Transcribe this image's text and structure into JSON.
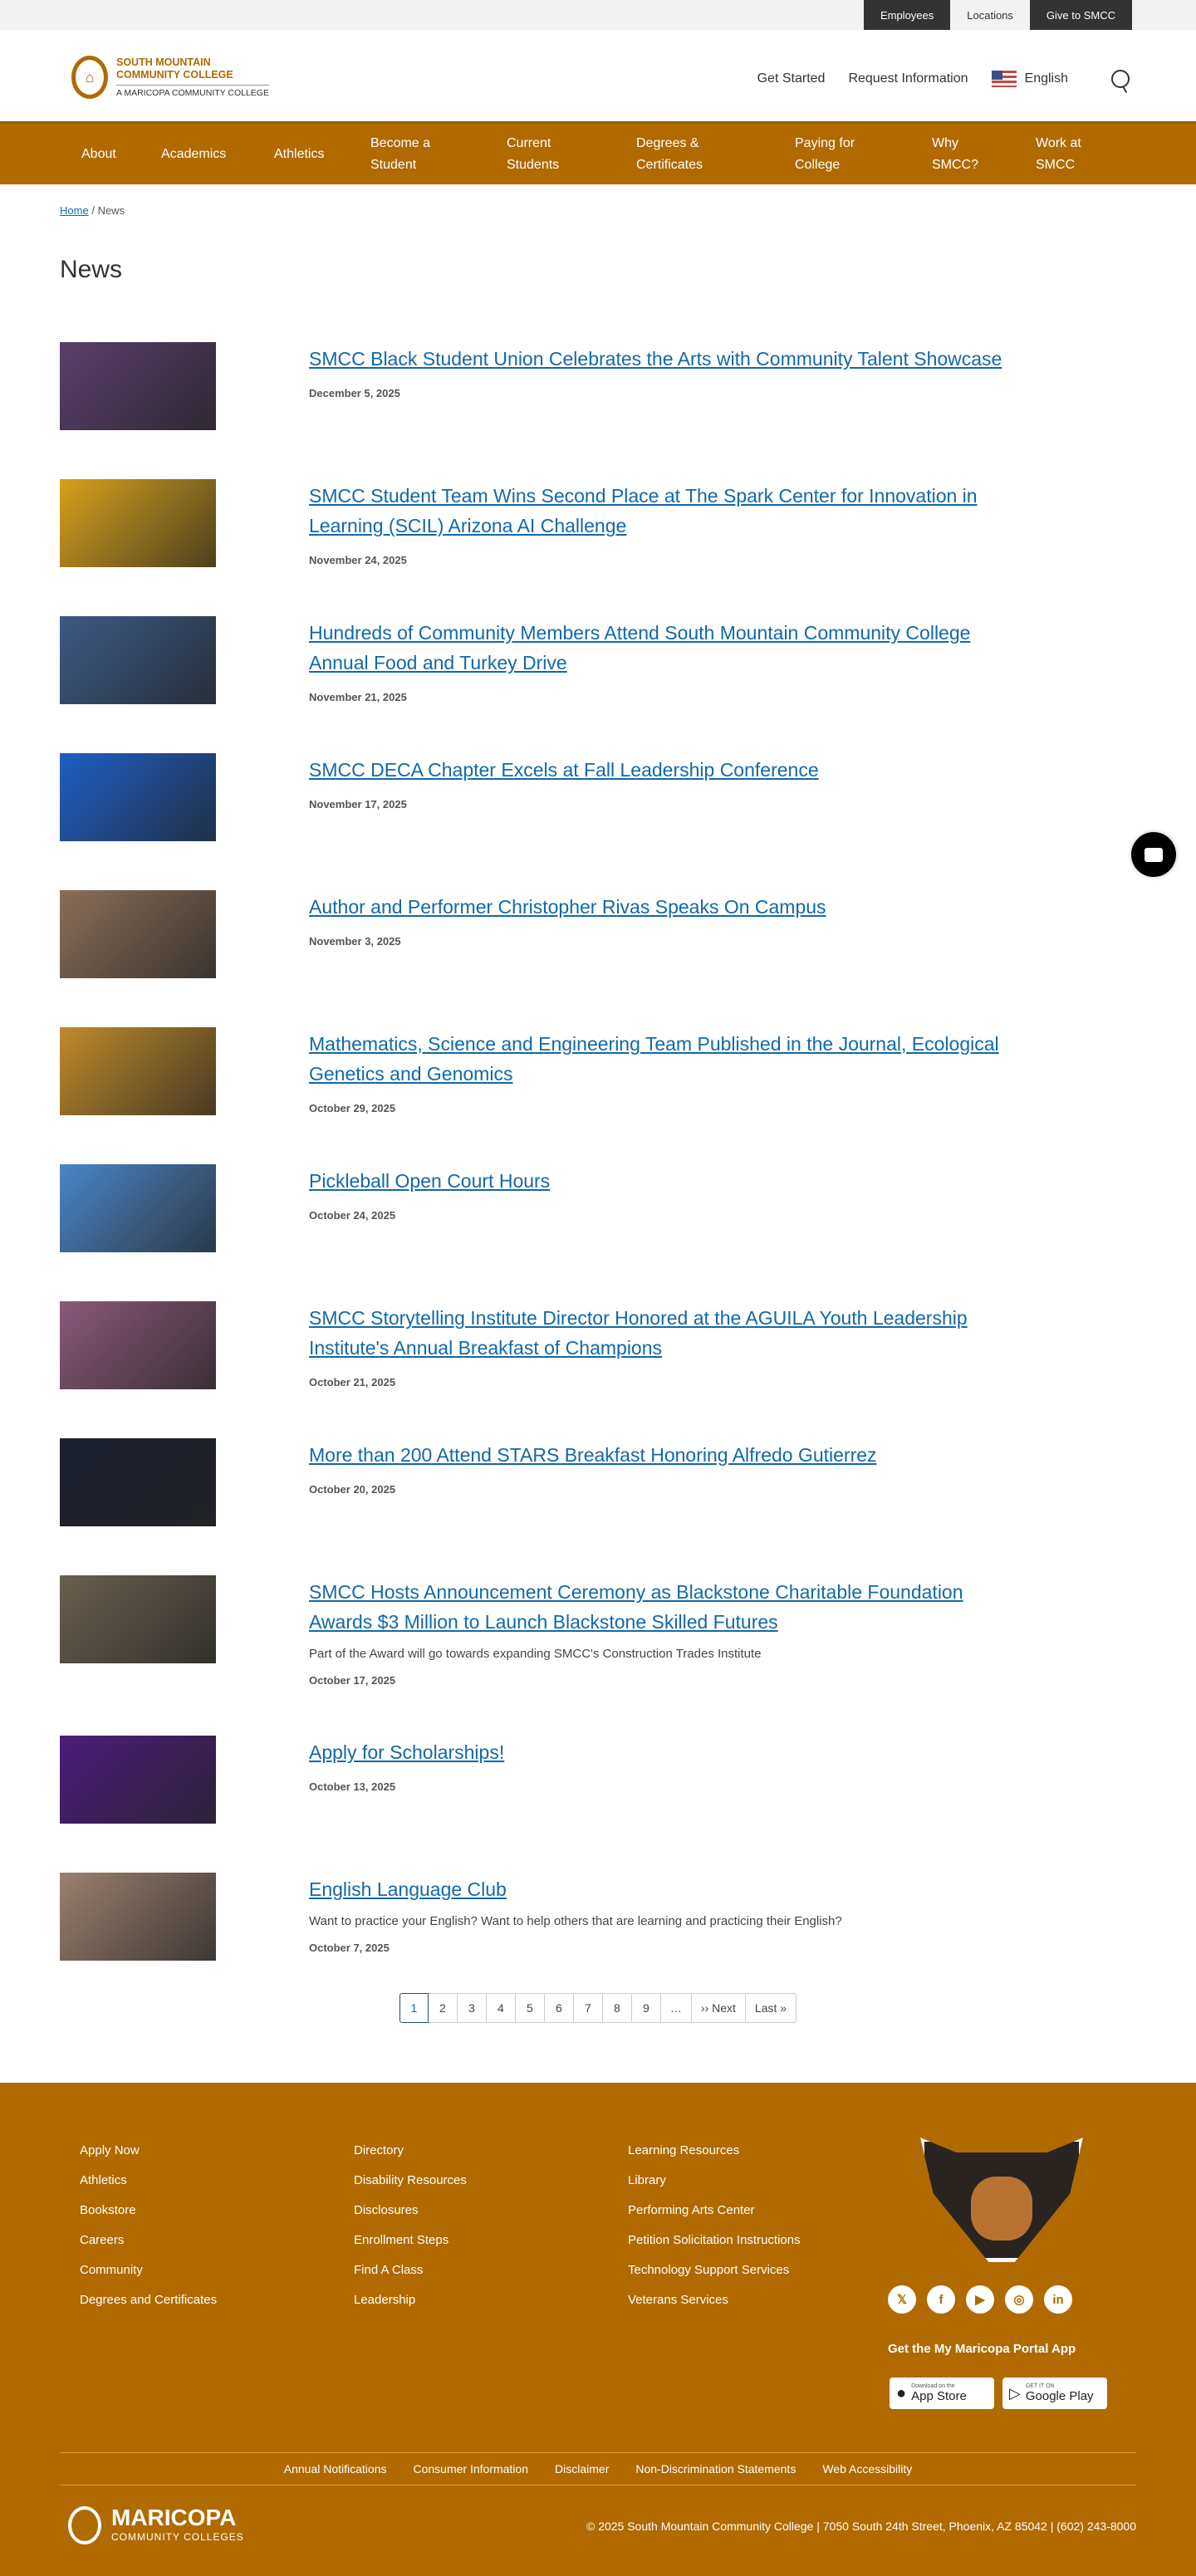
{
  "topbar": {
    "links": [
      "Employees",
      "Locations",
      "Give to SMCC"
    ]
  },
  "logo": {
    "line1": "SOUTH MOUNTAIN",
    "line2": "COMMUNITY COLLEGE",
    "line3": "A MARICOPA COMMUNITY COLLEGE"
  },
  "header": {
    "get_started": "Get Started",
    "request_info": "Request Information",
    "language": "English"
  },
  "nav": [
    "About",
    "Academics",
    "Athletics",
    "Become a Student",
    "Current Students",
    "Degrees & Certificates",
    "Paying for College",
    "Why SMCC?",
    "Work at SMCC"
  ],
  "breadcrumb": {
    "home": "Home",
    "sep": "/",
    "current": "News"
  },
  "page_title": "News",
  "items": [
    {
      "title": "SMCC Black Student Union Celebrates the Arts with Community Talent Showcase",
      "date": "December 5, 2025",
      "thumb": "#5a3f6b"
    },
    {
      "title": "SMCC Student Team Wins Second Place at The Spark Center for Innovation in Learning (SCIL) Arizona AI Challenge",
      "date": "November 24, 2025",
      "thumb": "#d9a11a"
    },
    {
      "title": "Hundreds of Community Members Attend South Mountain Community College Annual Food and Turkey Drive",
      "date": "November 21, 2025",
      "thumb": "#3d5a86"
    },
    {
      "title": "SMCC DECA Chapter Excels at Fall Leadership Conference",
      "date": "November 17, 2025",
      "thumb": "#1f5fc4"
    },
    {
      "title": "Author and Performer Christopher Rivas Speaks On Campus",
      "date": "November 3, 2025",
      "thumb": "#8a6f5a"
    },
    {
      "title": "Mathematics, Science and Engineering Team Published in the Journal, Ecological Genetics and Genomics",
      "date": "October 29, 2025",
      "thumb": "#c08a2a"
    },
    {
      "title": "Pickleball Open Court Hours",
      "date": "October 24, 2025",
      "thumb": "#4a86c8"
    },
    {
      "title": "SMCC Storytelling Institute Director Honored at the AGUILA Youth Leadership Institute's Annual Breakfast of Champions",
      "date": "October 21, 2025",
      "thumb": "#8a5a7a"
    },
    {
      "title": "More than 200 Attend STARS Breakfast Honoring Alfredo Gutierrez",
      "date": "October 20, 2025",
      "thumb": "#1c2030"
    },
    {
      "title": "SMCC Hosts Announcement Ceremony as Blackstone Charitable Foundation Awards $3 Million to Launch Blackstone Skilled Futures",
      "desc": "Part of the Award will go towards expanding SMCC's Construction Trades Institute",
      "date": "October 17, 2025",
      "thumb": "#6a6050"
    },
    {
      "title": "Apply for Scholarships!",
      "date": "October 13, 2025",
      "thumb": "#4b1e7a"
    },
    {
      "title": "English Language Club",
      "desc": "Want to practice your English? Want to help others that are learning and practicing their English?",
      "date": "October 7, 2025",
      "thumb": "#9a8070"
    }
  ],
  "pager": [
    "1",
    "2",
    "3",
    "4",
    "5",
    "6",
    "7",
    "8",
    "9",
    "…",
    "›› Next",
    "Last »"
  ],
  "footer": {
    "col1": [
      "Apply Now",
      "Athletics",
      "Bookstore",
      "Careers",
      "Community",
      "Degrees and Certificates"
    ],
    "col2": [
      "Directory",
      "Disability Resources",
      "Disclosures",
      "Enrollment Steps",
      "Find A Class",
      "Leadership"
    ],
    "col3": [
      "Learning Resources",
      "Library",
      "Performing Arts Center",
      "Petition Solicitation Instructions",
      "Technology Support Services",
      "Veterans Services"
    ],
    "social": [
      "𝕏",
      "f",
      "▶",
      "◎",
      "in"
    ],
    "app_title": "Get the My Maricopa Portal App",
    "appstore_small": "Download on the",
    "appstore": "App Store",
    "play_small": "GET IT ON",
    "play": "Google Play",
    "legal": [
      "Annual Notifications",
      "Consumer Information",
      "Disclaimer",
      "Non-Discrimination Statements",
      "Web Accessibility"
    ],
    "maricopa": "MARICOPA",
    "maricopa_sub": "COMMUNITY COLLEGES",
    "copyright": "© 2025 South Mountain Community College | 7050 South 24th Street, Phoenix, AZ 85042 | (602) 243-8000"
  }
}
